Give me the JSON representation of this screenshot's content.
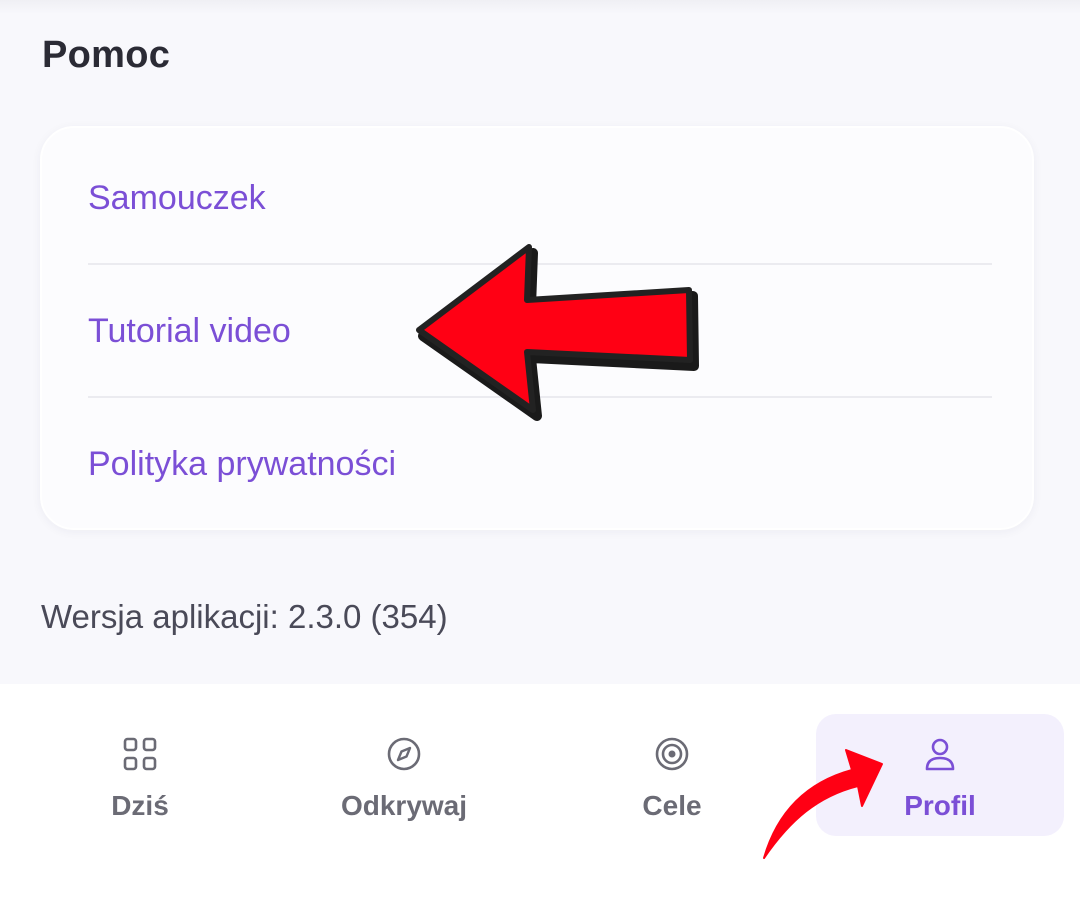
{
  "help": {
    "title": "Pomoc",
    "items": [
      {
        "label": "Samouczek"
      },
      {
        "label": "Tutorial video"
      },
      {
        "label": "Polityka prywatności"
      }
    ]
  },
  "version_text": "Wersja aplikacji: 2.3.0 (354)",
  "bottom_nav": {
    "active": "Profil",
    "items": [
      {
        "label": "Dziś",
        "icon": "grid-icon"
      },
      {
        "label": "Odkrywaj",
        "icon": "compass-icon"
      },
      {
        "label": "Cele",
        "icon": "target-icon"
      },
      {
        "label": "Profil",
        "icon": "user-icon"
      }
    ]
  },
  "colors": {
    "accent": "#7b4fd6",
    "annotation_arrow": "#ff0014",
    "background": "#f8f8fc"
  }
}
